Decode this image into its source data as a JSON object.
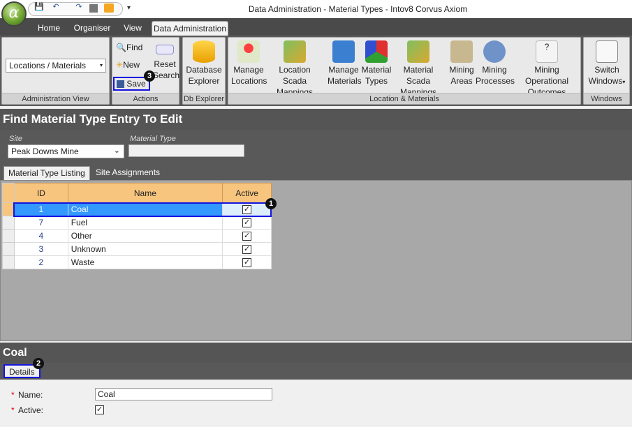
{
  "window": {
    "title": "Data Administration - Material Types - Intov8 Corvus Axiom",
    "logo_glyph": "α"
  },
  "qat": {
    "save": "💾",
    "undo": "↶",
    "redo": "↷",
    "more": "▾"
  },
  "menu_tabs": [
    "Home",
    "Organiser",
    "View",
    "Data Administration"
  ],
  "ribbon": {
    "admin_view": {
      "value": "Locations / Materials",
      "label": "Administration View"
    },
    "actions": {
      "find": "Find",
      "new": "New",
      "save": "Save",
      "reset1": "Reset",
      "reset2": "Search",
      "label": "Actions"
    },
    "db": {
      "line1": "Database",
      "line2": "Explorer",
      "label": "Db Explorer"
    },
    "loc_mat": {
      "label": "Location & Materials",
      "buttons": [
        {
          "l1": "Manage",
          "l2": "Locations"
        },
        {
          "l1": "Location Scada",
          "l2": "Mappings"
        },
        {
          "l1": "Manage",
          "l2": "Materials"
        },
        {
          "l1": "Material",
          "l2": "Types"
        },
        {
          "l1": "Material Scada",
          "l2": "Mappings"
        },
        {
          "l1": "Mining",
          "l2": "Areas"
        },
        {
          "l1": "Mining",
          "l2": "Processes"
        },
        {
          "l1": "Mining Operational",
          "l2": "Outcomes"
        }
      ]
    },
    "windows": {
      "l1": "Switch",
      "l2": "Windows",
      "label": "Windows"
    }
  },
  "find": {
    "title": "Find Material Type Entry To Edit",
    "site_label": "Site",
    "site_value": "Peak Downs Mine",
    "material_label": "Material Type",
    "material_value": ""
  },
  "sub_tabs": [
    "Material Type Listing",
    "Site Assignments"
  ],
  "grid": {
    "columns": [
      "ID",
      "Name",
      "Active"
    ],
    "rows": [
      {
        "id": "1",
        "name": "Coal",
        "active": true
      },
      {
        "id": "7",
        "name": "Fuel",
        "active": true
      },
      {
        "id": "4",
        "name": "Other",
        "active": true
      },
      {
        "id": "3",
        "name": "Unknown",
        "active": true
      },
      {
        "id": "2",
        "name": "Waste",
        "active": true
      }
    ]
  },
  "detail": {
    "title": "Coal",
    "tab": "Details",
    "name_label": "Name:",
    "name_value": "Coal",
    "active_label": "Active:",
    "required_mark": "*"
  },
  "callouts": [
    "1",
    "2",
    "3"
  ],
  "colors": {
    "accent": "#1414e0",
    "header_orange": "#f7c57e",
    "selection": "#3399ff"
  }
}
